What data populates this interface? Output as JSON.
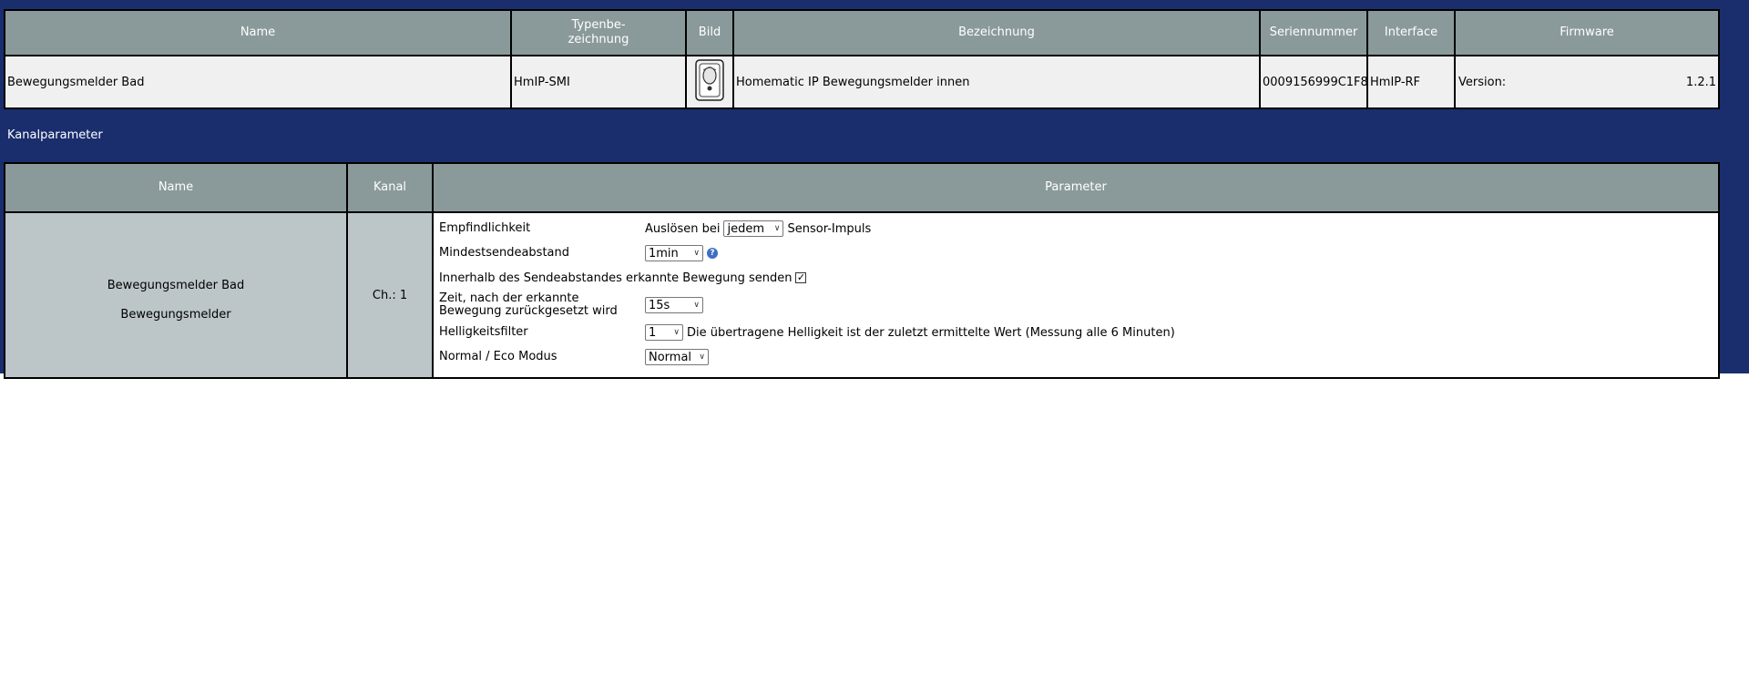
{
  "device_table": {
    "headers": {
      "name": "Name",
      "type": "Typenbe-\nzeichnung",
      "image": "Bild",
      "description": "Bezeichnung",
      "serial": "Seriennummer",
      "interface": "Interface",
      "firmware": "Firmware"
    },
    "row": {
      "name": "Bewegungsmelder Bad",
      "type": "HmIP-SMI",
      "image_icon": "motion-detector-device-icon",
      "description": "Homematic IP Bewegungsmelder innen",
      "serial": "0009156999C1F8",
      "interface": "HmIP-RF",
      "firmware_label": "Version:",
      "firmware_version": "1.2.1"
    }
  },
  "section_title": "Kanalparameter",
  "channel_table": {
    "headers": {
      "name": "Name",
      "kanal": "Kanal",
      "parameter": "Parameter"
    },
    "row": {
      "name_line1": "Bewegungsmelder Bad",
      "name_line2": "Bewegungsmelder",
      "kanal": "Ch.: 1",
      "params": {
        "sensitivity": {
          "label": "Empfindlichkeit",
          "prefix": "Auslösen bei",
          "value": "jedem",
          "suffix": "Sensor-Impuls"
        },
        "min_interval": {
          "label": "Mindestsendeabstand",
          "value": "1min"
        },
        "send_motion": {
          "label": "Innerhalb des Sendeabstandes erkannte Bewegung senden",
          "checked": true
        },
        "reset_time": {
          "label": "Zeit, nach der erkannte Bewegung zurückgesetzt wird",
          "value": "15s"
        },
        "brightness": {
          "label": "Helligkeitsfilter",
          "value": "1",
          "note": "Die übertragene Helligkeit ist der zuletzt ermittelte Wert (Messung alle 6 Minuten)"
        },
        "eco_mode": {
          "label": "Normal / Eco Modus",
          "value": "Normal"
        }
      }
    }
  },
  "colors": {
    "page_blue": "#1a2e6e",
    "header_gray": "#8a9a9a",
    "row_light": "#f0f0f0",
    "name_cell": "#bcc6c9"
  }
}
